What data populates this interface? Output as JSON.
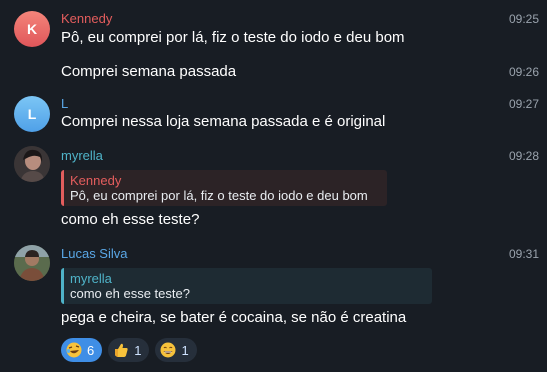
{
  "messages": [
    {
      "sender": "Kennedy",
      "avatar_letter": "K",
      "time": "09:25",
      "text": "Pô, eu comprei por lá, fiz o teste do iodo e deu bom"
    },
    {
      "time": "09:26",
      "text": "Comprei semana passada"
    },
    {
      "sender": "L",
      "avatar_letter": "L",
      "time": "09:27",
      "text": "Comprei nessa loja semana passada e é original"
    },
    {
      "sender": "myrella",
      "time": "09:28",
      "reply_name": "Kennedy",
      "reply_text": "Pô, eu comprei por lá, fiz o teste do iodo e deu bom",
      "text": "como eh esse teste?"
    },
    {
      "sender": "Lucas Silva",
      "time": "09:31",
      "reply_name": "myrella",
      "reply_text": "como eh esse teste?",
      "text": "pega e cheira, se bater é cocaina, se não é creatina"
    }
  ],
  "reactions": [
    {
      "emoji": "rolling-laughing-emoji",
      "count": "6",
      "active": true
    },
    {
      "emoji": "thumbs-up-emoji",
      "count": "1",
      "active": false
    },
    {
      "emoji": "grinning-emoji",
      "count": "1",
      "active": false
    }
  ],
  "colors": {
    "background": "#181d24",
    "kennedy": "#e35d5d",
    "link_blue": "#5aa7e6",
    "myrella_name": "#4fb3c8",
    "lucas_name": "#5aa7e6",
    "reply_kennedy_bg": "#2c2326",
    "reply_myrella_bg": "#1e2b33",
    "active_reaction": "#3f8ee6"
  }
}
